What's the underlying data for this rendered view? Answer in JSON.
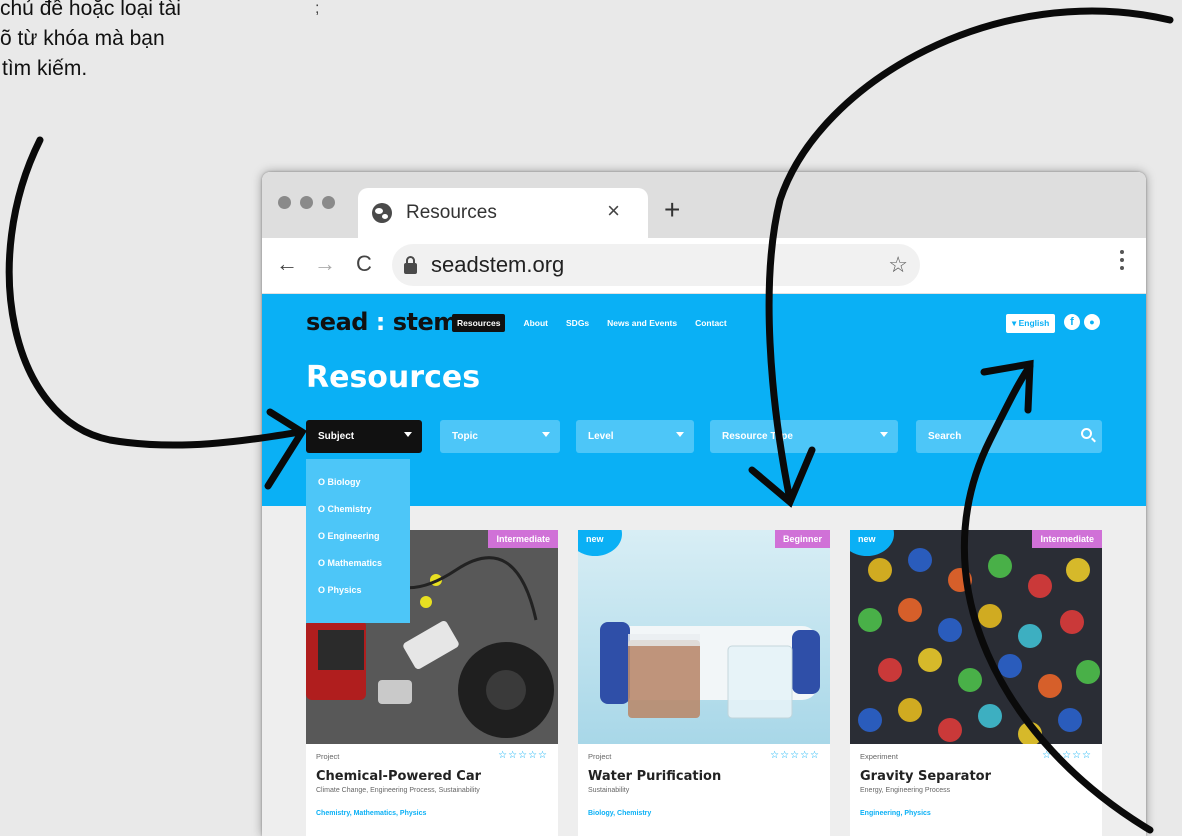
{
  "instruction_text": [
    "chủ đề hoặc loại tài",
    "õ từ khóa mà bạn",
    "tìm kiếm."
  ],
  "stray_text": ";",
  "browser": {
    "tab_title": "Resources",
    "tab_close": "×",
    "new_tab": "+",
    "back": "←",
    "forward": "→",
    "reload": "C",
    "url": "seadstem.org",
    "bookmark": "☆"
  },
  "site": {
    "logo": {
      "part1": "sead",
      "colon": ":",
      "part2": "stem"
    },
    "nav": [
      "Resources",
      "About",
      "SDGs",
      "News and Events",
      "Contact"
    ],
    "language": "▾ English",
    "social": {
      "facebook": "f",
      "account": "●"
    },
    "page_title": "Resources",
    "filters": {
      "subject": "Subject",
      "topic": "Topic",
      "level": "Level",
      "resource_type": "Resource Type",
      "search": "Search"
    },
    "subject_options": [
      "O Biology",
      "O Chemistry",
      "O Engineering",
      "O Mathematics",
      "O Physics"
    ],
    "cards": [
      {
        "level": "Intermediate",
        "new": "",
        "type": "Project",
        "title": "Chemical-Powered Car",
        "tags": "Climate Change, Engineering Process, Sustainability",
        "subjects": "Chemistry, Mathematics, Physics",
        "stars": "☆☆☆☆☆"
      },
      {
        "level": "Beginner",
        "new": "new",
        "type": "Project",
        "title": "Water Purification",
        "tags": "Sustainability",
        "subjects": "Biology, Chemistry",
        "stars": "☆☆☆☆☆"
      },
      {
        "level": "Intermediate",
        "new": "new",
        "type": "Experiment",
        "title": "Gravity Separator",
        "tags": "Energy, Engineering Process",
        "subjects": "Engineering, Physics",
        "stars": "☆☆☆☆☆"
      }
    ]
  },
  "colors": {
    "brand_blue": "#0ab0f5",
    "level_badge": "#d071d7",
    "dark": "#111111"
  }
}
